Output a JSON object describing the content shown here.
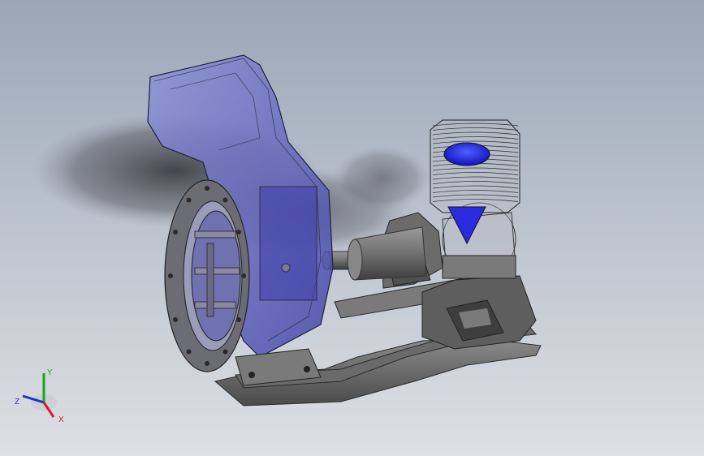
{
  "viewport": {
    "background_top": "#9aa6b6",
    "background_bottom": "#dde0e4"
  },
  "model": {
    "parts": [
      "volute-casing",
      "inlet-flange",
      "impeller",
      "shaft",
      "bearing-housing",
      "engine-cylinder",
      "base-frame"
    ],
    "transparent_color": "#5a5cc0",
    "metal_color": "#6e6e6e",
    "engine_accent": "#2020e0"
  },
  "triad": {
    "x_label": "X",
    "y_label": "Y",
    "z_label": "Z",
    "x_color": "#d42020",
    "y_color": "#20a020",
    "z_color": "#2030c0"
  }
}
